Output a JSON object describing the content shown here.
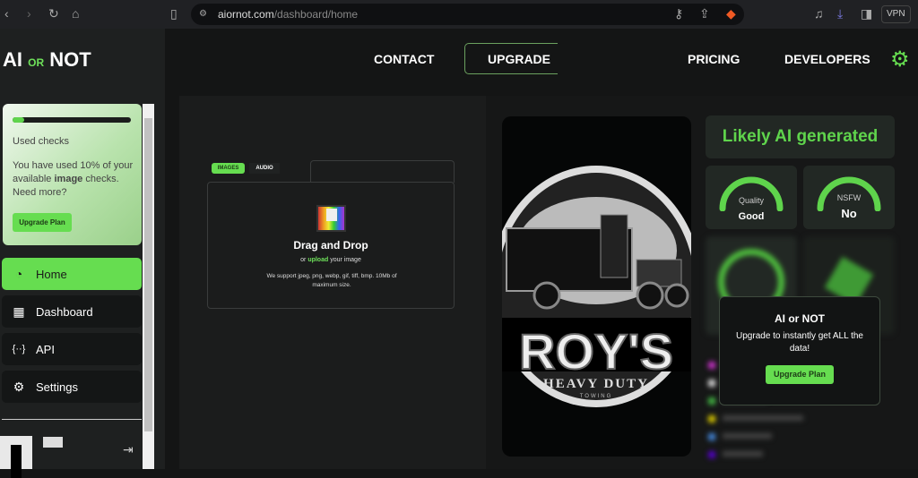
{
  "browser": {
    "url_host": "aiornot.com",
    "url_path": "/dashboard/home",
    "vpn": "VPN"
  },
  "logo": {
    "left": "AI",
    "mid": "OR",
    "right": "NOT"
  },
  "topnav": {
    "contact": "CONTACT",
    "upgrade": "UPGRADE",
    "pricing": "PRICING",
    "developers": "DEVELOPERS"
  },
  "usage": {
    "progress_percent": 10,
    "title": "Used checks",
    "text_a": "You have used 10% of your available ",
    "text_bold": "image",
    "text_b": " checks. Need more?",
    "button": "Upgrade Plan"
  },
  "sidebar": {
    "items": [
      {
        "label": "Home"
      },
      {
        "label": "Dashboard"
      },
      {
        "label": "API"
      },
      {
        "label": "Settings"
      }
    ]
  },
  "upload": {
    "tabs": [
      "IMAGES",
      "AUDIO"
    ],
    "title": "Drag and Drop",
    "or": "or ",
    "link": "upload",
    "rest": " your image",
    "support": "We support jpeg, png, webp, gif, tiff, bmp. 10Mb of maximum size."
  },
  "image_logo": {
    "name": "ROY'S",
    "line1": "HEAVY DUTY",
    "line2": "TOWING"
  },
  "result": {
    "verdict": "Likely AI generated",
    "quality_label": "Quality",
    "quality_value": "Good",
    "nsfw_label": "NSFW",
    "nsfw_value": "No"
  },
  "modal": {
    "title": "AI or NOT",
    "text": "Upgrade to instantly get ALL the data!",
    "button": "Upgrade Plan"
  },
  "colors": {
    "accent": "#66dd50"
  }
}
